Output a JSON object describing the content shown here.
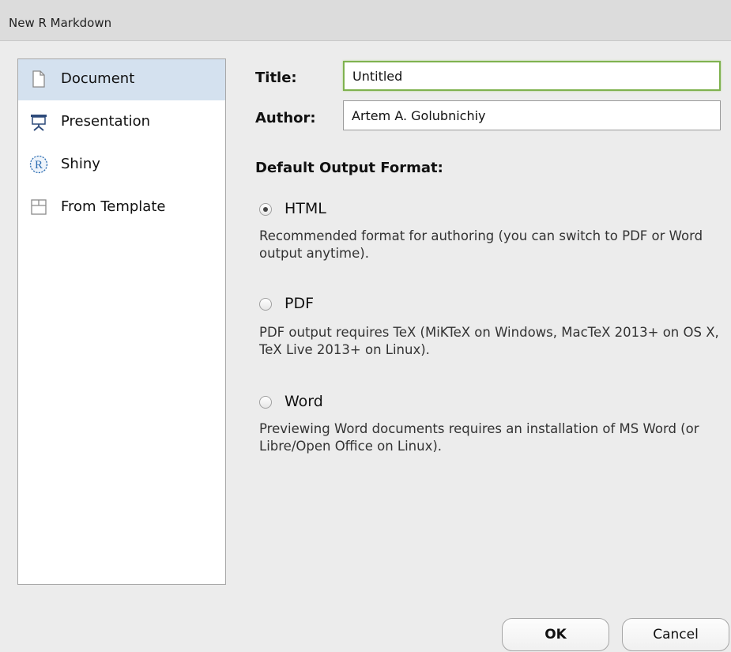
{
  "window": {
    "title": "New R Markdown"
  },
  "sidebar": {
    "items": [
      {
        "label": "Document",
        "icon": "document-icon",
        "selected": true
      },
      {
        "label": "Presentation",
        "icon": "presentation-icon",
        "selected": false
      },
      {
        "label": "Shiny",
        "icon": "r-shiny-icon",
        "selected": false
      },
      {
        "label": "From Template",
        "icon": "template-icon",
        "selected": false
      }
    ]
  },
  "form": {
    "title_label": "Title:",
    "title_value": "Untitled",
    "author_label": "Author:",
    "author_value": "Artem A. Golubnichiy",
    "output_heading": "Default Output Format:",
    "options": [
      {
        "label": "HTML",
        "checked": true,
        "description": "Recommended format for authoring (you can switch to PDF or Word output anytime)."
      },
      {
        "label": "PDF",
        "checked": false,
        "description": "PDF output requires TeX (MiKTeX on Windows, MacTeX 2013+ on OS X, TeX Live 2013+ on Linux)."
      },
      {
        "label": "Word",
        "checked": false,
        "description": "Previewing Word documents requires an installation of MS Word (or Libre/Open Office on Linux)."
      }
    ]
  },
  "buttons": {
    "ok": "OK",
    "cancel": "Cancel"
  },
  "colors": {
    "selected_bg": "#d4e1ef",
    "focus_border": "#7fb24f",
    "r_blue": "#2f6fb3"
  }
}
